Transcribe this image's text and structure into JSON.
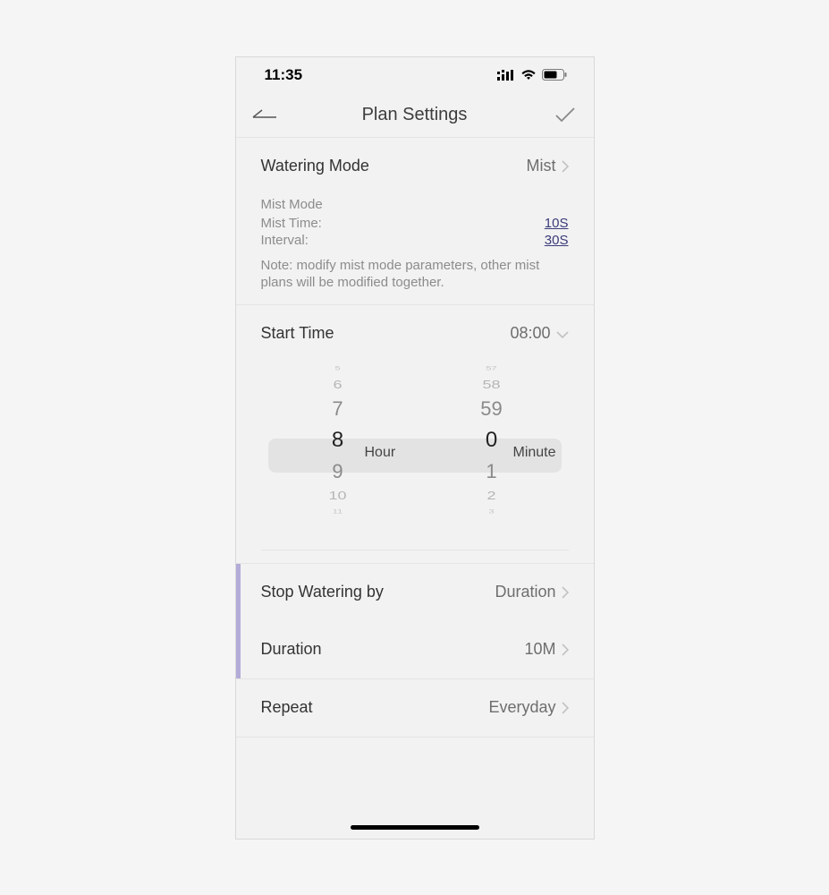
{
  "status": {
    "time": "11:35"
  },
  "nav": {
    "title": "Plan Settings"
  },
  "watering_mode": {
    "label": "Watering Mode",
    "value": "Mist"
  },
  "mist": {
    "heading": "Mist Mode",
    "time_label": "Mist Time:",
    "time_value": "10S",
    "interval_label": "Interval:",
    "interval_value": "30S",
    "note": "Note: modify mist mode parameters, other mist plans will be modified together."
  },
  "start_time": {
    "label": "Start Time",
    "value": "08:00"
  },
  "picker": {
    "hour_label": "Hour",
    "minute_label": "Minute",
    "hours": {
      "t0": "5",
      "t1": "6",
      "t2": "7",
      "sel": "8",
      "b1": "9",
      "b2": "10",
      "b3": "11"
    },
    "minutes": {
      "t0": "57",
      "t1": "58",
      "t2": "59",
      "sel": "0",
      "b1": "1",
      "b2": "2",
      "b3": "3"
    }
  },
  "stop_by": {
    "label": "Stop Watering by",
    "value": "Duration"
  },
  "duration": {
    "label": "Duration",
    "value": "10M"
  },
  "repeat": {
    "label": "Repeat",
    "value": "Everyday"
  }
}
